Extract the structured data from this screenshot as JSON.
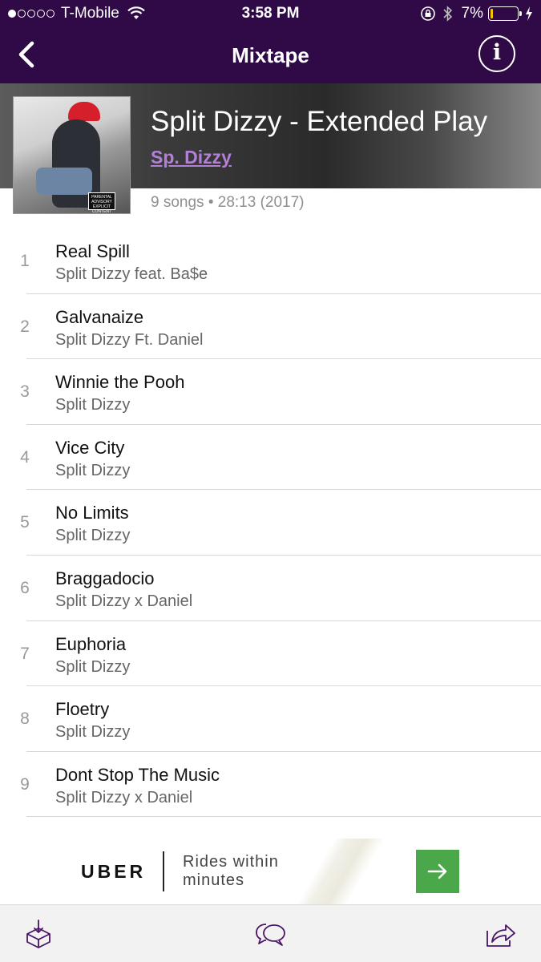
{
  "status_bar": {
    "carrier": "T-Mobile",
    "time": "3:58 PM",
    "battery": "7%",
    "signal_bars": 1
  },
  "nav": {
    "title": "Mixtape",
    "info_label": "i"
  },
  "album": {
    "title": "Split Dizzy - Extended Play",
    "artist": "Sp. Dizzy",
    "meta": "9 songs • 28:13 (2017)",
    "advisory_text": "PARENTAL ADVISORY EXPLICIT CONTENT"
  },
  "tracks": [
    {
      "num": "1",
      "title": "Real Spill",
      "artist": "Split Dizzy feat. Ba$e"
    },
    {
      "num": "2",
      "title": "Galvanaize",
      "artist": "Split Dizzy Ft. Daniel"
    },
    {
      "num": "3",
      "title": "Winnie the Pooh",
      "artist": "Split Dizzy"
    },
    {
      "num": "4",
      "title": "Vice City",
      "artist": "Split Dizzy"
    },
    {
      "num": "5",
      "title": "No Limits",
      "artist": "Split Dizzy"
    },
    {
      "num": "6",
      "title": "Braggadocio",
      "artist": "Split Dizzy x Daniel"
    },
    {
      "num": "7",
      "title": "Euphoria",
      "artist": "Split Dizzy"
    },
    {
      "num": "8",
      "title": "Floetry",
      "artist": "Split Dizzy"
    },
    {
      "num": "9",
      "title": "Dont Stop The Music",
      "artist": "Split Dizzy x Daniel"
    }
  ],
  "ad": {
    "brand": "UBER",
    "tagline": "Rides within minutes",
    "cta_icon": "arrow-right-icon"
  },
  "toolbar": {
    "download_icon": "download-box-icon",
    "comments_icon": "chat-bubbles-icon",
    "share_icon": "share-icon"
  },
  "colors": {
    "header_purple": "#2f0a46",
    "artist_link": "#b47fd6",
    "ad_green": "#4aa84a",
    "battery_low": "#f2c500"
  }
}
